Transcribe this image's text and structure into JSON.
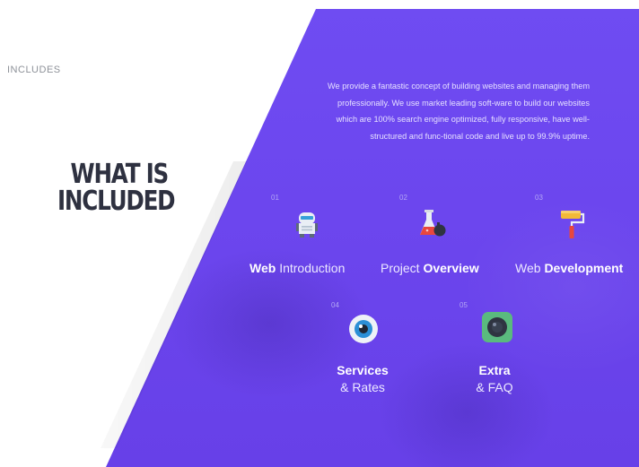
{
  "section": {
    "label": "INCLUDES",
    "heading_line1": "WHAT IS",
    "heading_line2": "INCLUDED"
  },
  "intro": {
    "text": "We provide a fantastic concept of building websites and managing them professionally. We use market leading soft-ware to build our websites which are 100% search engine optimized, fully responsive, have well-structured and func-tional code and live up to 99.9% uptime."
  },
  "features": [
    {
      "number": "01",
      "icon": "robot-icon",
      "title_bold": "Web",
      "title_light": "Introduction"
    },
    {
      "number": "02",
      "icon": "flask-icon",
      "title_light": "Project",
      "title_bold": "Overview"
    },
    {
      "number": "03",
      "icon": "paint-roller-icon",
      "title_light": "Web",
      "title_bold": "Development"
    },
    {
      "number": "04",
      "icon": "eye-icon",
      "title_bold": "Services",
      "title_light": "& Rates"
    },
    {
      "number": "05",
      "icon": "camera-lens-icon",
      "title_bold": "Extra",
      "title_light": "& FAQ"
    }
  ],
  "colors": {
    "panel": "#6c46ee",
    "heading": "#2e3140",
    "label": "#8e9299"
  }
}
